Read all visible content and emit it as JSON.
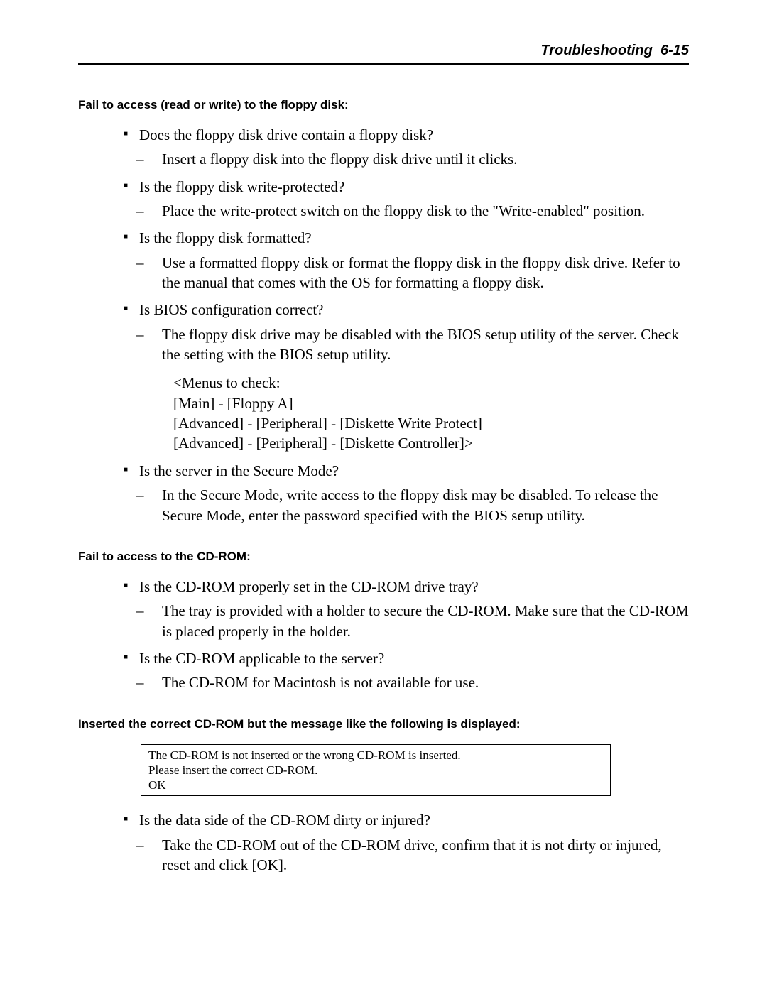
{
  "header": {
    "section": "Troubleshooting",
    "page": "6-15"
  },
  "sec1": {
    "title": "Fail to access (read or write) to the floppy disk:",
    "items": [
      {
        "q": "Does the floppy disk drive contain a floppy disk?",
        "a": "Insert a floppy disk into the floppy disk drive until it clicks."
      },
      {
        "q": "Is the floppy disk write-protected?",
        "a": "Place the write-protect switch on the floppy disk to the \"Write-enabled\" position."
      },
      {
        "q": "Is the floppy disk formatted?",
        "a": "Use a formatted floppy disk or format the floppy disk in the floppy disk drive.  Refer to the manual that comes with the OS for formatting a floppy disk."
      },
      {
        "q": "Is BIOS configuration correct?",
        "a": "The floppy disk drive may be disabled with the BIOS setup utility of the server.  Check the setting with the BIOS setup utility.",
        "menus": [
          "<Menus to check:",
          "[Main] - [Floppy A]",
          "[Advanced] - [Peripheral] - [Diskette Write Protect]",
          "[Advanced] - [Peripheral] - [Diskette Controller]>"
        ]
      },
      {
        "q": "Is the server in the Secure Mode?",
        "a": "In the Secure Mode, write access to the floppy disk may be disabled.  To release the Secure Mode, enter the password specified with the BIOS setup utility."
      }
    ]
  },
  "sec2": {
    "title": "Fail to access to the CD-ROM:",
    "items": [
      {
        "q": "Is the CD-ROM properly set in the CD-ROM drive tray?",
        "a": "The tray is provided with a holder to secure the CD-ROM.  Make sure that the CD-ROM is placed properly in the holder."
      },
      {
        "q": "Is the CD-ROM applicable to the server?",
        "a": "The CD-ROM for Macintosh is not available for use."
      }
    ]
  },
  "sec3": {
    "title": "Inserted the correct CD-ROM but the message like the following is displayed:",
    "msg": [
      "The CD-ROM is not inserted or the wrong CD-ROM is inserted.",
      "Please insert the correct CD-ROM.",
      "OK"
    ],
    "items": [
      {
        "q": "Is the data side of the CD-ROM dirty or injured?",
        "a": "Take the CD-ROM out of the CD-ROM drive, confirm that it is not dirty or injured, reset and click [OK]."
      }
    ]
  }
}
